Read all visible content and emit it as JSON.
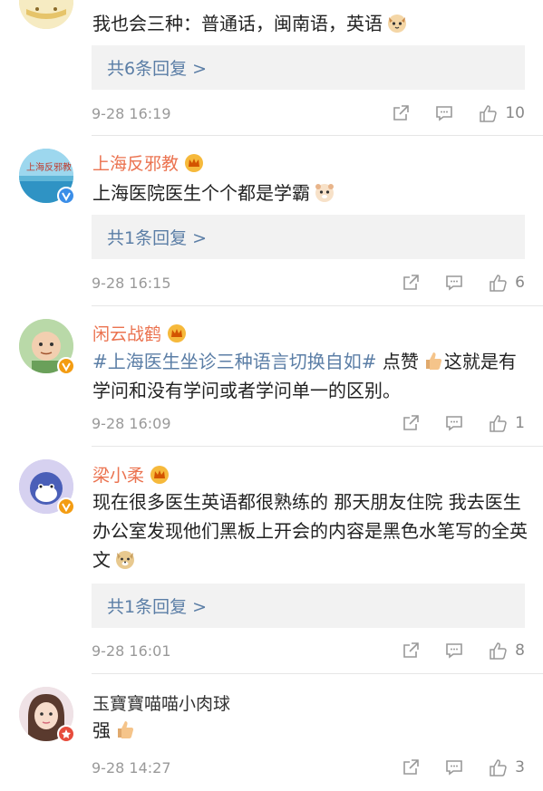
{
  "comments": [
    {
      "text": "我也会三种：普通话，闽南语，英语",
      "emoji": "cat-face",
      "replies": "共6条回复 >",
      "time": "9-28 16:19",
      "likes": "10"
    },
    {
      "username": "上海反邪教",
      "text": "上海医院医生个个都是学霸",
      "emoji": "hamster-face",
      "replies": "共1条回复 >",
      "time": "9-28 16:15",
      "likes": "6"
    },
    {
      "username": "闲云战鹤",
      "hashtag": "#上海医生坐诊三种语言切换自如#",
      "text_after_tag": " 点赞",
      "text_after_emoji": "这就是有学问和没有学问或者学问单一的区别。",
      "time": "9-28 16:09",
      "likes": "1"
    },
    {
      "username": "梁小柔",
      "text": "现在很多医生英语都很熟练的 那天朋友住院 我去医生办公室发现他们黑板上开会的内容是黑色水笔写的全英文",
      "emoji": "doge-face",
      "replies": "共1条回复 >",
      "time": "9-28 16:01",
      "likes": "8"
    },
    {
      "username": "玉寶寶喵喵小肉球",
      "text": "强",
      "emoji": "thumbs-up",
      "time": "9-28 14:27",
      "likes": "3"
    }
  ],
  "colors": {
    "username": "#eb7350",
    "link": "#5b7ea6",
    "meta": "#999999",
    "reply_bg": "#f2f2f2"
  }
}
